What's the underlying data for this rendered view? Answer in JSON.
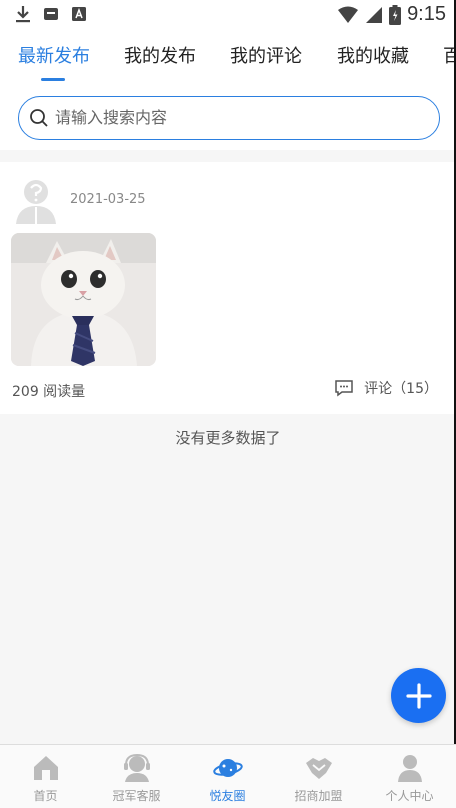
{
  "status_bar": {
    "time": "9:15",
    "left_icons": [
      "download-icon",
      "sim-icon",
      "font-icon"
    ],
    "right_icons": [
      "wifi-icon",
      "signal-icon",
      "battery-icon"
    ]
  },
  "tabs": [
    {
      "label": "最新发布",
      "active": true
    },
    {
      "label": "我的发布",
      "active": false
    },
    {
      "label": "我的评论",
      "active": false
    },
    {
      "label": "我的收藏",
      "active": false
    },
    {
      "label": "百",
      "active": false
    }
  ],
  "search": {
    "placeholder": "请输入搜索内容"
  },
  "post": {
    "date": "2021-03-25",
    "read_count": "209 阅读量",
    "comment_label": "评论（15）"
  },
  "feed": {
    "end_text": "没有更多数据了"
  },
  "bottom_nav": [
    {
      "label": "首页",
      "icon": "home-icon",
      "active": false
    },
    {
      "label": "冠军客服",
      "icon": "customer-service-icon",
      "active": false
    },
    {
      "label": "悦友圈",
      "icon": "planet-icon",
      "active": true
    },
    {
      "label": "招商加盟",
      "icon": "handshake-icon",
      "active": false
    },
    {
      "label": "个人中心",
      "icon": "person-icon",
      "active": false
    }
  ],
  "colors": {
    "accent": "#2b7fe0",
    "fab": "#1a6ff2",
    "inactive_nav": "#999999"
  }
}
